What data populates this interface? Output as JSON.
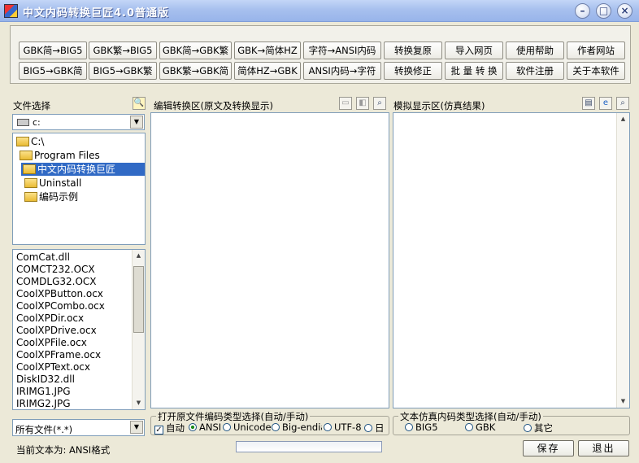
{
  "window": {
    "title": "中文内码转换巨匠4.0普通版",
    "minimize": "–",
    "maximize": "□",
    "close": "×"
  },
  "toolbar": {
    "row1": [
      "GBK简→BIG5",
      "GBK繁→BIG5",
      "GBK简→GBK繁",
      "GBK→简体HZ",
      "字符→ANSI内码",
      "转换复原",
      "导入网页",
      "使用帮助",
      "作者网站"
    ],
    "row2": [
      "BIG5→GBK简",
      "BIG5→GBK繁",
      "GBK繁→GBK简",
      "简体HZ→GBK",
      "ANSI内码→字符",
      "转换修正",
      "批 量 转 换",
      "软件注册",
      "关于本软件"
    ]
  },
  "file_select": {
    "label": "文件选择",
    "drive": "c:",
    "tree": [
      "C:\\",
      "Program Files",
      "中文内码转换巨匠",
      "Uninstall",
      "编码示例"
    ],
    "files": [
      "ComCat.dll",
      "COMCT232.OCX",
      "COMDLG32.OCX",
      "CoolXPButton.ocx",
      "CoolXPCombo.ocx",
      "CoolXPDir.ocx",
      "CoolXPDrive.ocx",
      "CoolXPFile.ocx",
      "CoolXPFrame.ocx",
      "CoolXPText.ocx",
      "DiskID32.dll",
      "IRIMG1.JPG",
      "IRIMG2.JPG"
    ],
    "filter": "所有文件(*.*)"
  },
  "edit_area": {
    "label": "编辑转换区(原文及转换显示)"
  },
  "preview_area": {
    "label": "模拟显示区(仿真结果)"
  },
  "open_encoding": {
    "legend": "打开原文件编码类型选择(自动/手动)",
    "auto_label": "自动",
    "options": [
      "ANSI",
      "Unicode",
      "Big-endian",
      "UTF-8",
      "日"
    ],
    "selected": "ANSI"
  },
  "sim_encoding": {
    "legend": "文本仿真内码类型选择(自动/手动)",
    "options": [
      "BIG5",
      "GBK",
      "其它"
    ]
  },
  "status": {
    "text": "当前文本为: ANSI格式"
  },
  "buttons": {
    "save": "保存",
    "exit": "退出"
  }
}
